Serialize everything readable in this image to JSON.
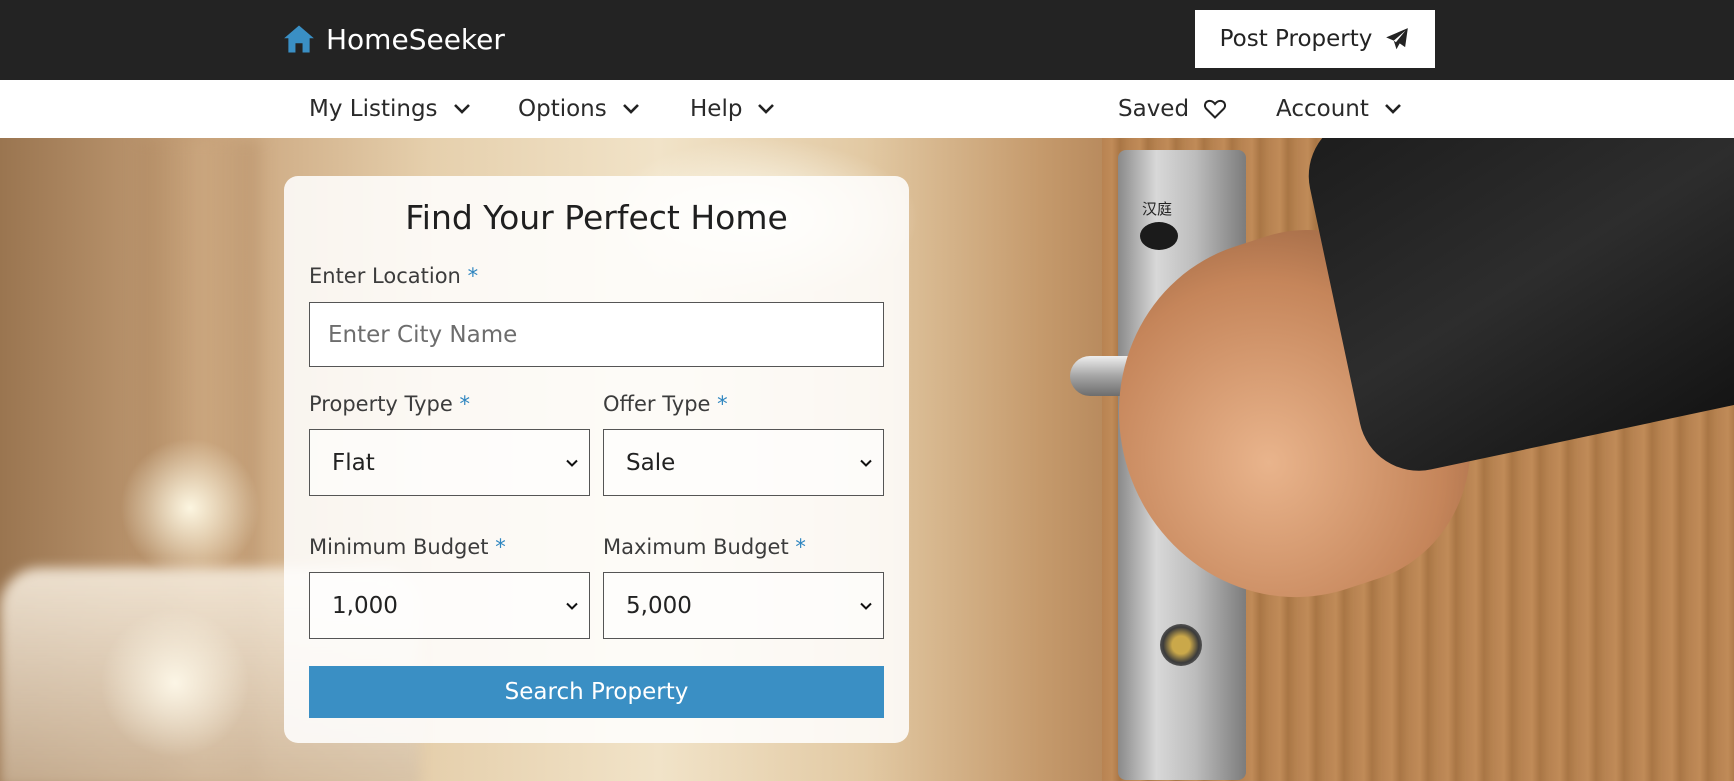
{
  "header": {
    "brand_name": "HomeSeeker",
    "brand_icon": "house-icon",
    "post_property_label": "Post Property",
    "post_property_icon": "paper-plane-icon"
  },
  "nav": {
    "items": [
      {
        "label": "My Listings",
        "icon": "chevron-down-icon"
      },
      {
        "label": "Options",
        "icon": "chevron-down-icon"
      },
      {
        "label": "Help",
        "icon": "chevron-down-icon"
      },
      {
        "label": "Saved",
        "icon": "heart-icon"
      },
      {
        "label": "Account",
        "icon": "chevron-down-icon"
      }
    ]
  },
  "search_form": {
    "title": "Find Your Perfect Home",
    "location": {
      "label": "Enter Location",
      "required_mark": "*",
      "placeholder": "Enter City Name",
      "value": ""
    },
    "property_type": {
      "label": "Property Type",
      "required_mark": "*",
      "selected": "Flat"
    },
    "offer_type": {
      "label": "Offer Type",
      "required_mark": "*",
      "selected": "Sale"
    },
    "min_budget": {
      "label": "Minimum Budget",
      "required_mark": "*",
      "selected": "1,000"
    },
    "max_budget": {
      "label": "Maximum Budget",
      "required_mark": "*",
      "selected": "5,000"
    },
    "submit_label": "Search Property"
  },
  "hero": {
    "door_sign_text": "汉庭"
  },
  "colors": {
    "header_bg": "#232323",
    "accent": "#3a8fc4",
    "required_mark": "#2f86c0",
    "brand_icon": "#3a8fc4"
  }
}
